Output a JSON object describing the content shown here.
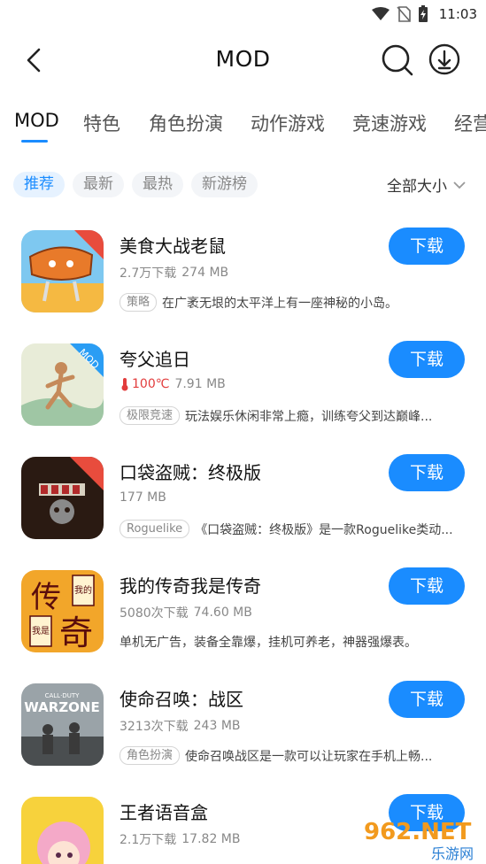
{
  "status": {
    "time": "11:03"
  },
  "header": {
    "title": "MOD"
  },
  "categories": [
    "MOD",
    "特色",
    "角色扮演",
    "动作游戏",
    "竞速游戏",
    "经营"
  ],
  "filters": {
    "chips": [
      "推荐",
      "最新",
      "最热",
      "新游榜"
    ],
    "size_filter": "全部大小"
  },
  "colors": {
    "accent": "#1a8cff",
    "hot": "#e23c3c"
  },
  "apps": [
    {
      "name": "美食大战老鼠",
      "downloads": "2.7万下载",
      "size": "274 MB",
      "tag": "策略",
      "desc": "在广袤无垠的太平洋上有一座神秘的小岛。",
      "button": "下载",
      "icon": "food-war-icon"
    },
    {
      "name": "夸父追日",
      "temp": "100℃",
      "size": "7.91 MB",
      "tag": "极限竞速",
      "desc": "玩法娱乐休闲非常上瘾，训练夸父到达巅峰...",
      "button": "下载",
      "icon": "kuafu-icon"
    },
    {
      "name": "口袋盗贼：终极版",
      "size": "177 MB",
      "tag": "Roguelike",
      "desc": "《口袋盗贼：终极版》是一款Roguelike类动...",
      "button": "下载",
      "icon": "pocket-rogues-icon"
    },
    {
      "name": "我的传奇我是传奇",
      "downloads": "5080次下载",
      "size": "74.60 MB",
      "desc": "单机无广告，装备全靠爆，挂机可养老，神器强爆表。",
      "button": "下载",
      "icon": "legend-icon",
      "icon_text": [
        "传",
        "奇",
        "我的",
        "我是"
      ]
    },
    {
      "name": "使命召唤：战区",
      "downloads": "3213次下载",
      "size": "243 MB",
      "tag": "角色扮演",
      "desc": "使命召唤战区是一款可以让玩家在手机上畅...",
      "button": "下载",
      "icon": "warzone-icon",
      "icon_text": [
        "CALL·DUTY",
        "WARZONE"
      ]
    },
    {
      "name": "王者语音盒",
      "downloads": "2.1万下载",
      "size": "17.82 MB",
      "button": "下载",
      "icon": "voice-box-icon"
    }
  ],
  "mod_badge": "MOD",
  "watermark": {
    "brand": "962.NET",
    "sub": "乐游网"
  }
}
